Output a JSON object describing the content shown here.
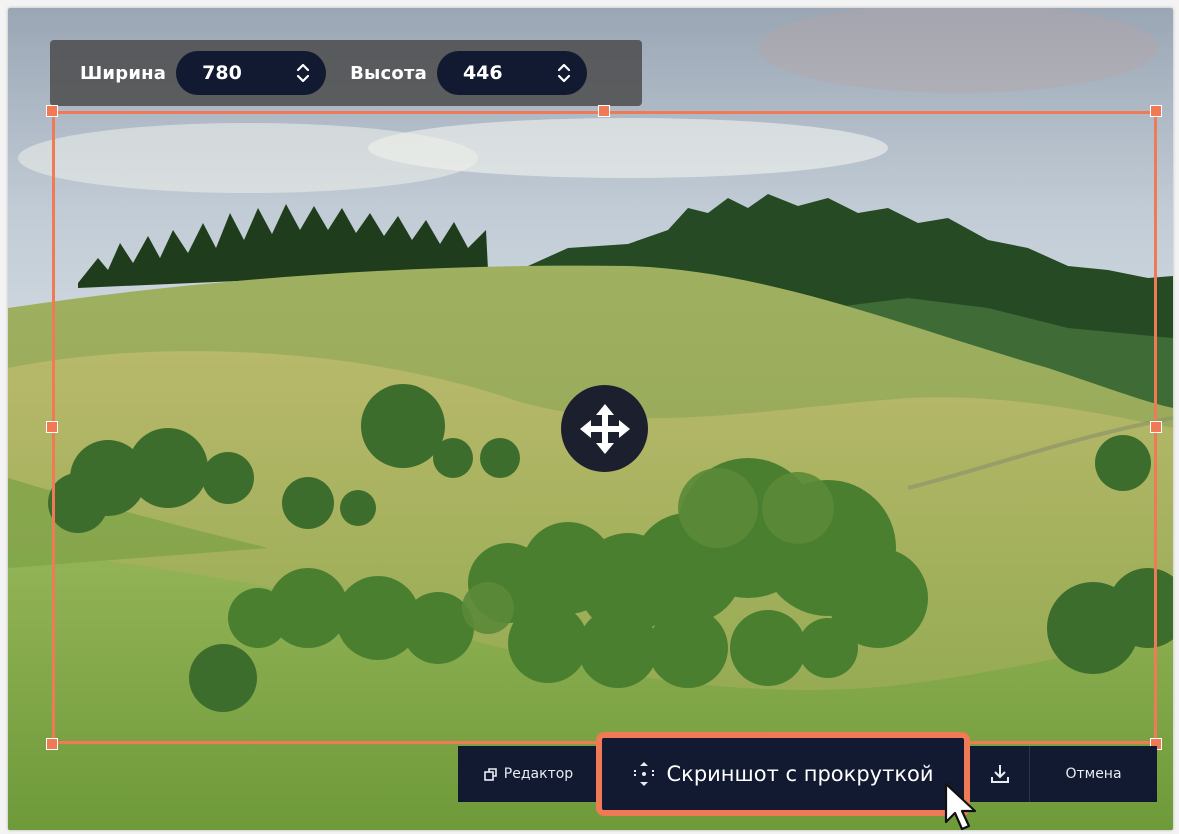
{
  "size_toolbar": {
    "width_label": "Ширина",
    "width_value": "780",
    "height_label": "Высота",
    "height_value": "446"
  },
  "actions": {
    "editor_label": "Редактор",
    "scroll_screenshot_label": "Скриншот с прокруткой",
    "cancel_label": "Отмена"
  },
  "icons": {
    "move": "move-arrows-icon",
    "editor": "editor-icon",
    "scroll": "scroll-capture-icon",
    "download": "download-icon",
    "stepper": "chevron-up-down-icon",
    "cursor": "mouse-pointer-icon"
  },
  "colors": {
    "selection": "#f07a55",
    "toolbar_dark": "#121a31",
    "toolbar_gray": "#484848"
  }
}
